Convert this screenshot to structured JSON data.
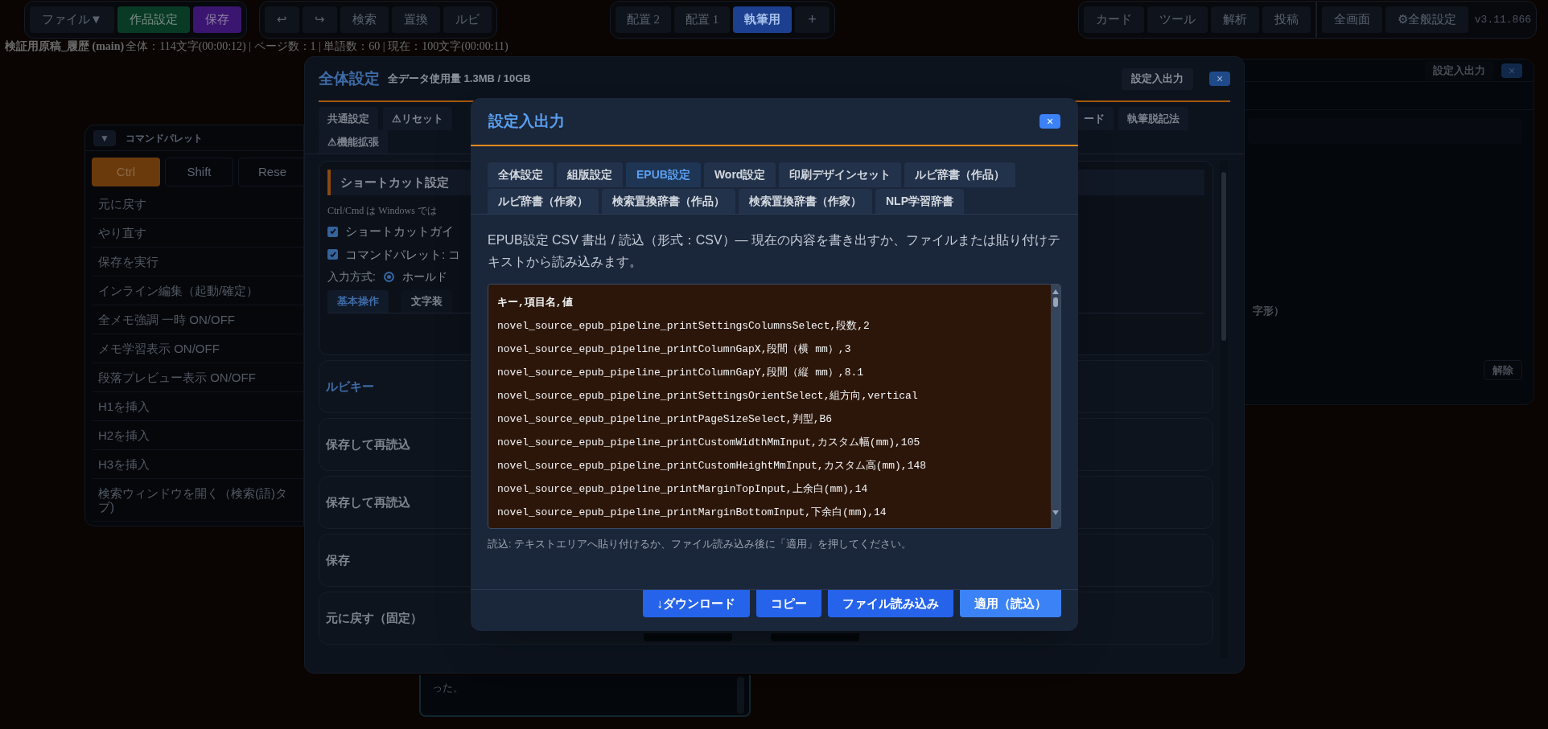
{
  "toolbar": {
    "file_group": [
      {
        "label": "ファイル▼",
        "kind": "plain"
      },
      {
        "label": "作品設定",
        "kind": "green"
      },
      {
        "label": "保存",
        "kind": "purple"
      }
    ],
    "edit_group": [
      {
        "label": "↩",
        "kind": "plain"
      },
      {
        "label": "↪",
        "kind": "plain"
      },
      {
        "label": "検索",
        "kind": "plain"
      },
      {
        "label": "置換",
        "kind": "plain"
      },
      {
        "label": "ルビ",
        "kind": "plain"
      }
    ],
    "layouts": [
      {
        "label": "配置 2",
        "selected": false
      },
      {
        "label": "配置 1",
        "selected": false
      },
      {
        "label": "執筆用",
        "selected": true
      }
    ],
    "add_layout": "+",
    "panel_group": [
      {
        "label": "カード",
        "kind": "plain"
      },
      {
        "label": "ツール",
        "kind": "plain"
      },
      {
        "label": "解析",
        "kind": "plain"
      },
      {
        "label": "投稿",
        "kind": "plain"
      }
    ],
    "view_group": [
      {
        "label": "全画面",
        "kind": "plain"
      },
      {
        "label": "⚙全般設定",
        "kind": "plain"
      }
    ],
    "version": "v3.11.866"
  },
  "status": {
    "document": "検証用原稿_履歴 (main)",
    "stats": "全体：114文字(00:00:12) | ページ数：1 | 単語数：60 | 現在：100文字(00:00:11)"
  },
  "command_palette": {
    "toggle": "▼",
    "title": "コマンドパレット",
    "modifiers": [
      {
        "label": "Ctrl",
        "selected": true
      },
      {
        "label": "Shift",
        "selected": false
      },
      {
        "label": "Rese",
        "selected": false
      }
    ],
    "items": [
      "元に戻す",
      "やり直す",
      "保存を実行",
      "インライン編集（起動/確定）",
      "全メモ強調 一時 ON/OFF",
      "メモ学習表示 ON/OFF",
      "段落プレビュー表示 ON/OFF",
      "H1を挿入",
      "H2を挿入",
      "H3を挿入",
      "検索ウィンドウを開く（検索(語)タブ)"
    ]
  },
  "background_panel": {
    "io_button": "設定入出力",
    "close": "×",
    "note": "字形）",
    "clear_button": "解除"
  },
  "editor_snippet": "った。",
  "settings_dialog": {
    "title": "全体設定",
    "usage": "全データ使用量 1.3MB / 10GB",
    "io_button": "設定入出力",
    "close": "×",
    "tab_rows": [
      [
        {
          "label": "共通設定",
          "selected": false
        },
        {
          "label": "⚠リセット",
          "selected": false
        },
        {
          "label": "ード",
          "selected": false
        },
        {
          "label": "執筆脱記法",
          "selected": false
        }
      ],
      [
        {
          "label": "⚠機能拡張",
          "selected": false
        }
      ]
    ],
    "shortcuts": {
      "title": "ショートカット設定",
      "note": "Ctrl/Cmd は Windows では",
      "options": [
        {
          "label": "ショートカットガイ",
          "checked": true
        },
        {
          "label": "コマンドパレット: コ",
          "checked": true
        }
      ],
      "input_mode": {
        "label": "入力方式:",
        "choices": [
          {
            "label": "ホールド",
            "selected": true
          }
        ]
      },
      "categories": [
        {
          "label": "基本操作",
          "selected": true
        },
        {
          "label": "文字装",
          "selected": false
        }
      ]
    },
    "cards": [
      {
        "title": "ルビキー",
        "kind": "accent"
      },
      {
        "title": "保存して再読込",
        "kind": "plain"
      },
      {
        "title": "保存して再読込",
        "kind": "plain"
      },
      {
        "title": "保存",
        "kind": "plain"
      },
      {
        "title": "元に戻す（固定）",
        "kind": "fields"
      }
    ]
  },
  "io_dialog": {
    "title": "設定入出力",
    "close": "×",
    "tab_rows": [
      [
        {
          "label": "全体設定",
          "selected": false
        },
        {
          "label": "組版設定",
          "selected": false
        },
        {
          "label": "EPUB設定",
          "selected": true
        },
        {
          "label": "Word設定",
          "selected": false
        },
        {
          "label": "印刷デザインセット",
          "selected": false
        },
        {
          "label": "ルビ辞書（作品）",
          "selected": false
        }
      ],
      [
        {
          "label": "ルビ辞書（作家）",
          "selected": false
        },
        {
          "label": "検索置換辞書（作品）",
          "selected": false
        },
        {
          "label": "検索置換辞書（作家）",
          "selected": false
        },
        {
          "label": "NLP学習辞書",
          "selected": false
        }
      ]
    ],
    "description": "EPUB設定 CSV 書出 / 読込（形式：CSV）— 現在の内容を書き出すか、ファイルまたは貼り付けテキストから読み込みます。",
    "csv_lines": [
      "キー,項目名,値",
      "novel_source_epub_pipeline_printSettingsColumnsSelect,段数,2",
      "novel_source_epub_pipeline_printColumnGapX,段間（横 mm）,3",
      "novel_source_epub_pipeline_printColumnGapY,段間（縦 mm）,8.1",
      "novel_source_epub_pipeline_printSettingsOrientSelect,組方向,vertical",
      "novel_source_epub_pipeline_printPageSizeSelect,判型,B6",
      "novel_source_epub_pipeline_printCustomWidthMmInput,カスタム幅(mm),105",
      "novel_source_epub_pipeline_printCustomHeightMmInput,カスタム高(mm),148",
      "novel_source_epub_pipeline_printMarginTopInput,上余白(mm),14",
      "novel_source_epub_pipeline_printMarginBottomInput,下余白(mm),14"
    ],
    "hint": "読込: テキストエリアへ貼り付けるか、ファイル読み込み後に「適用」を押してください。",
    "buttons": [
      {
        "label": "↓ダウンロード",
        "kind": "primary"
      },
      {
        "label": "コピー",
        "kind": "primary"
      },
      {
        "label": "ファイル読み込み",
        "kind": "primary"
      },
      {
        "label": "適用（読込）",
        "kind": "apply"
      }
    ]
  }
}
